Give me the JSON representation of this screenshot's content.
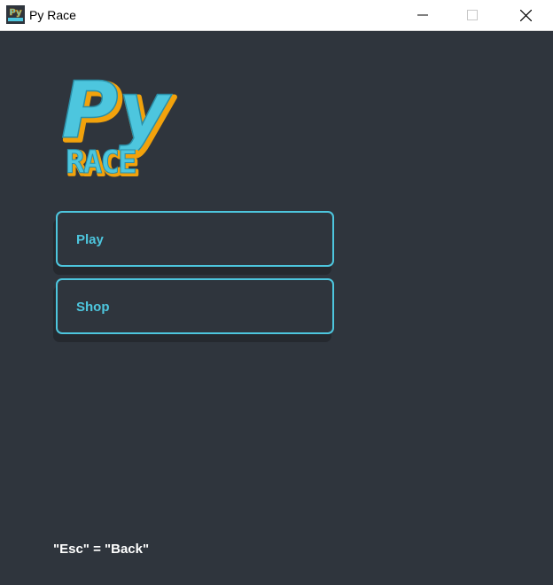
{
  "window": {
    "title": "Py Race",
    "icon": "py-race-app-icon"
  },
  "logo": {
    "line1": "Py",
    "line2": "RACE",
    "colors": {
      "fill": "#4dc6de",
      "outline": "#f2a20c"
    }
  },
  "menu": {
    "buttons": [
      {
        "label": "Play"
      },
      {
        "label": "Shop"
      }
    ]
  },
  "footer": {
    "hint": "\"Esc\" = \"Back\""
  },
  "colors": {
    "background": "#2f353d",
    "accent": "#4dc6de",
    "logo_outline": "#f2a20c"
  }
}
